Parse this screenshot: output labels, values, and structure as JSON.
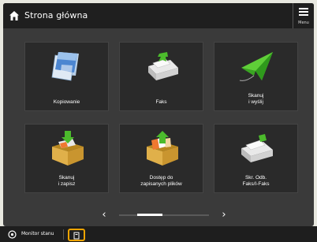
{
  "header": {
    "title": "Strona główna",
    "menu_label": "Menu"
  },
  "tiles": [
    {
      "label": "Kopiowanie",
      "icon": "copy-documents-icon"
    },
    {
      "label": "Faks",
      "icon": "fax-icon"
    },
    {
      "label": "Skanuj\ni wyślij",
      "icon": "scan-send-icon"
    },
    {
      "label": "Skanuj\ni zapisz",
      "icon": "scan-store-icon"
    },
    {
      "label": "Dostęp do\nzapisanych plików",
      "icon": "stored-files-icon"
    },
    {
      "label": "Skr. Odb.\nFaks/I-Faks",
      "icon": "fax-inbox-icon"
    }
  ],
  "pager": {
    "prev": "‹",
    "next": "›",
    "position": 0.28
  },
  "status": {
    "text": "Monitor stanu",
    "icon": "status-monitor-icon",
    "button_icon": "device-icon"
  },
  "colors": {
    "accent": "#f0a400",
    "background": "#3a3a3a",
    "topbar": "#1f1f1f",
    "arrow_green": "#4cbb2c"
  }
}
